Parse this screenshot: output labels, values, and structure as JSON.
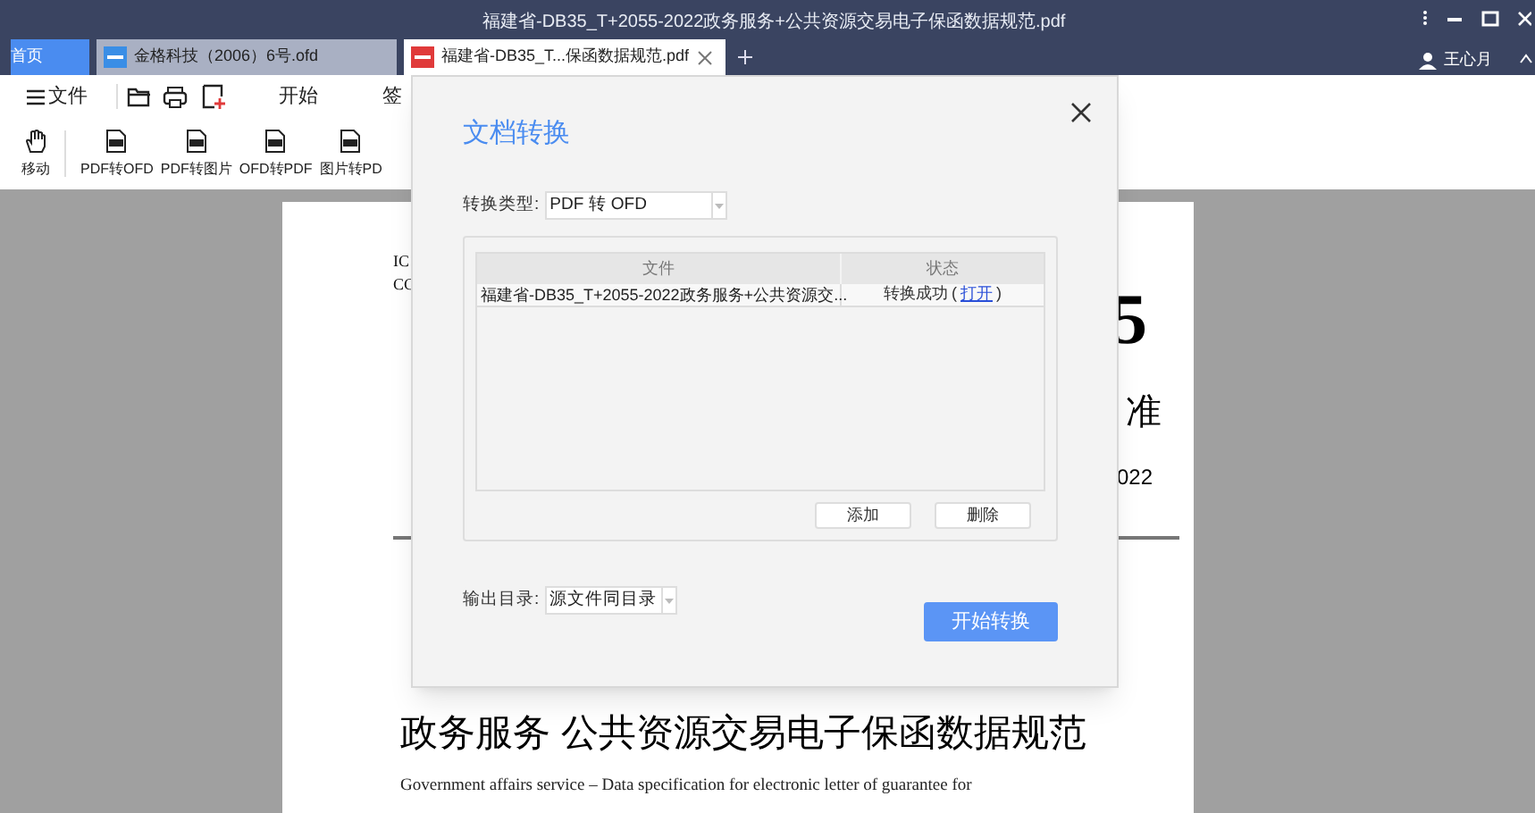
{
  "window": {
    "title": "福建省-DB35_T+2055-2022政务服务+公共资源交易电子保函数据规范.pdf"
  },
  "user": {
    "name": "王心月"
  },
  "tabs": [
    {
      "label": "首页",
      "kind": "home",
      "selected": false,
      "closable": false
    },
    {
      "label": "金格科技（2006）6号.ofd",
      "kind": "ofd",
      "selected": false,
      "closable": false
    },
    {
      "label": "福建省-DB35_T...保函数据规范.pdf",
      "kind": "pdf",
      "selected": true,
      "closable": true
    }
  ],
  "toolbar": {
    "file_menu": "文件",
    "ribbon_tabs": [
      "开始",
      "签"
    ],
    "tools": [
      {
        "label": "移动",
        "kind": "hand"
      },
      {
        "label": "PDF转OFD",
        "kind": "file"
      },
      {
        "label": "PDF转图片",
        "kind": "file"
      },
      {
        "label": "OFD转PDF",
        "kind": "file"
      },
      {
        "label": "图片转PD",
        "kind": "file"
      }
    ]
  },
  "document": {
    "code_lines": [
      "IC",
      "CC"
    ],
    "number": "5",
    "title_right": "准",
    "date": "022",
    "heading": "政务服务  公共资源交易电子保函数据规范",
    "subtitle": "Government affairs service – Data specification for electronic letter of guarantee for"
  },
  "dialog": {
    "title": "文档转换",
    "type_label": "转换类型:",
    "type_value": "PDF 转 OFD",
    "columns": [
      "文件",
      "状态"
    ],
    "rows": [
      {
        "file": "福建省-DB35_T+2055-2022政务服务+公共资源交...",
        "status": "转换成功",
        "link_prefix": "(",
        "link": "打开",
        "link_suffix": ")"
      }
    ],
    "list_buttons": [
      "添加",
      "删除"
    ],
    "output_label": "输出目录:",
    "output_value": "源文件同目录",
    "start_button": "开始转换"
  }
}
